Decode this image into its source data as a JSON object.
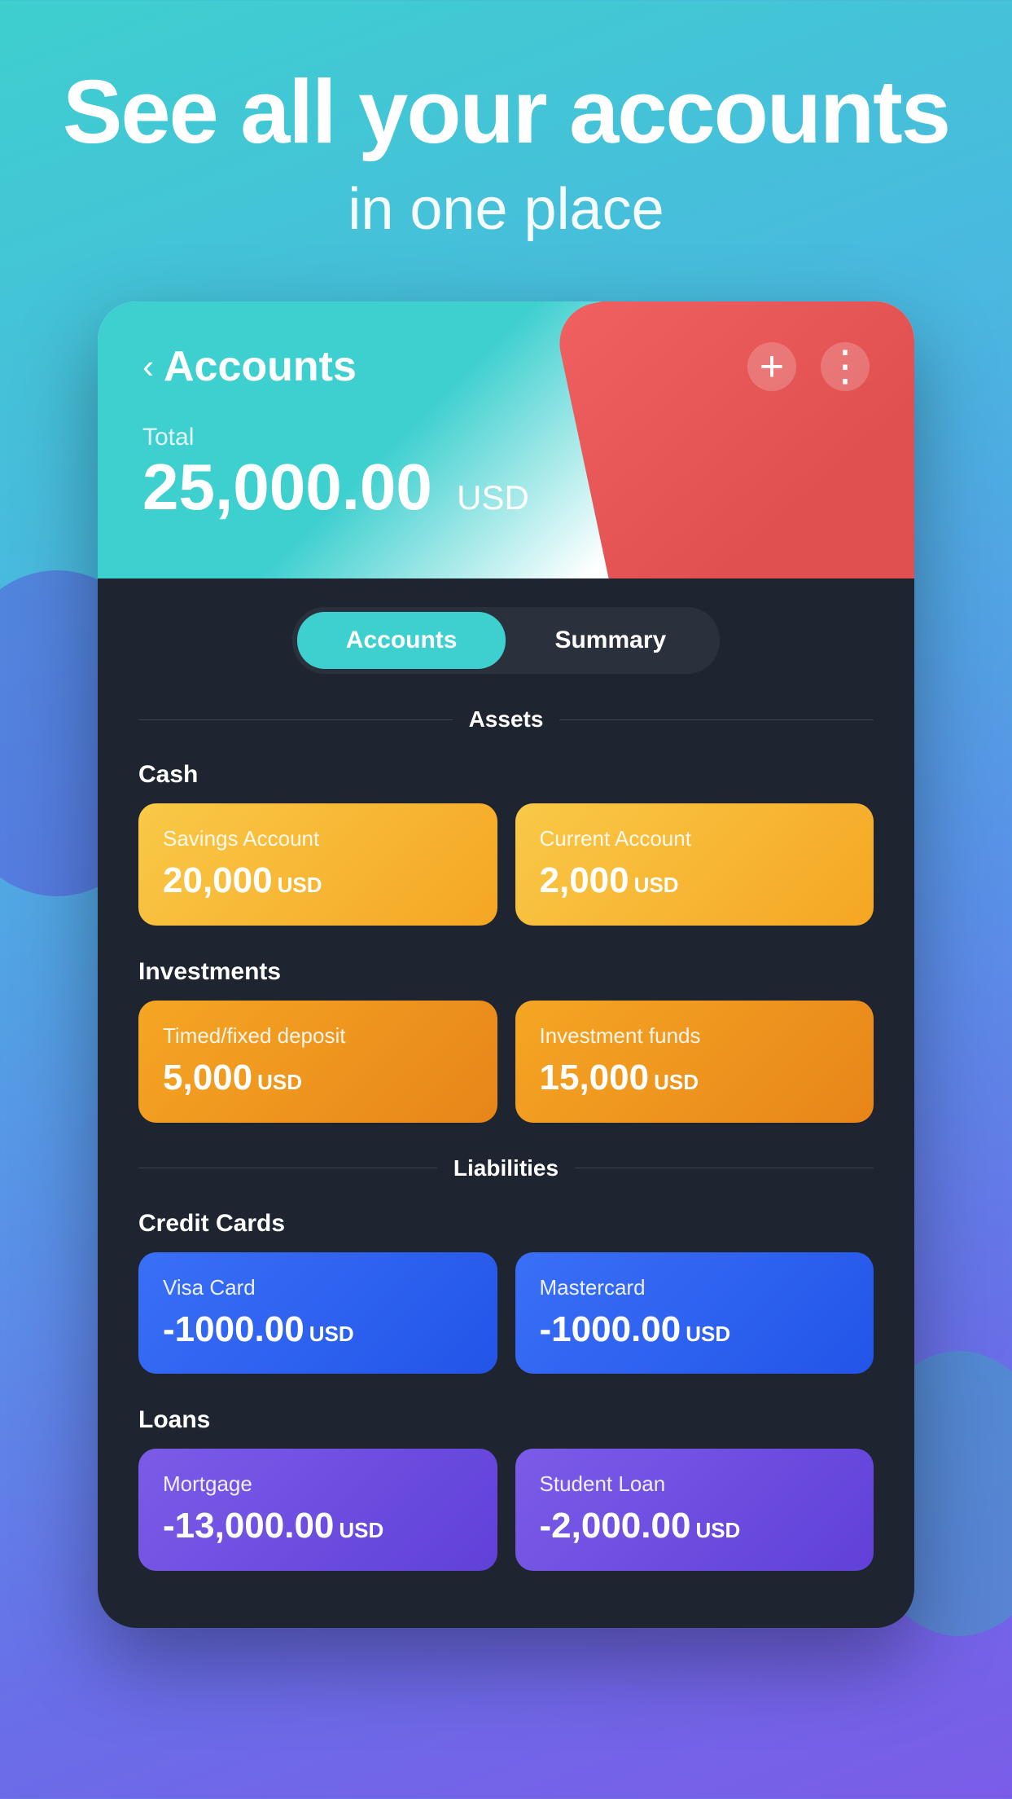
{
  "hero": {
    "title": "See all your accounts",
    "subtitle": "in one place"
  },
  "card": {
    "back_icon": "‹",
    "title": "Accounts",
    "add_label": "+",
    "menu_label": "⋮",
    "total_label": "Total",
    "total_amount": "25,000.00",
    "total_currency": "USD"
  },
  "tabs": {
    "accounts_label": "Accounts",
    "summary_label": "Summary",
    "active": "accounts"
  },
  "sections": {
    "assets_label": "Assets",
    "liabilities_label": "Liabilities"
  },
  "categories": {
    "cash_label": "Cash",
    "investments_label": "Investments",
    "credit_cards_label": "Credit Cards",
    "loans_label": "Loans"
  },
  "accounts": {
    "cash": [
      {
        "name": "Savings Account",
        "amount": "20,000",
        "currency": "USD",
        "style": "yellow"
      },
      {
        "name": "Current Account",
        "amount": "2,000",
        "currency": "USD",
        "style": "yellow"
      }
    ],
    "investments": [
      {
        "name": "Timed/fixed deposit",
        "amount": "5,000",
        "currency": "USD",
        "style": "orange"
      },
      {
        "name": "Investment funds",
        "amount": "15,000",
        "currency": "USD",
        "style": "orange"
      }
    ],
    "credit_cards": [
      {
        "name": "Visa Card",
        "amount": "-1000.00",
        "currency": "USD",
        "style": "blue"
      },
      {
        "name": "Mastercard",
        "amount": "-1000.00",
        "currency": "USD",
        "style": "blue"
      }
    ],
    "loans": [
      {
        "name": "Mortgage",
        "amount": "-13,000.00",
        "currency": "USD",
        "style": "purple"
      },
      {
        "name": "Student Loan",
        "amount": "-2,000.00",
        "currency": "USD",
        "style": "purple"
      }
    ]
  }
}
